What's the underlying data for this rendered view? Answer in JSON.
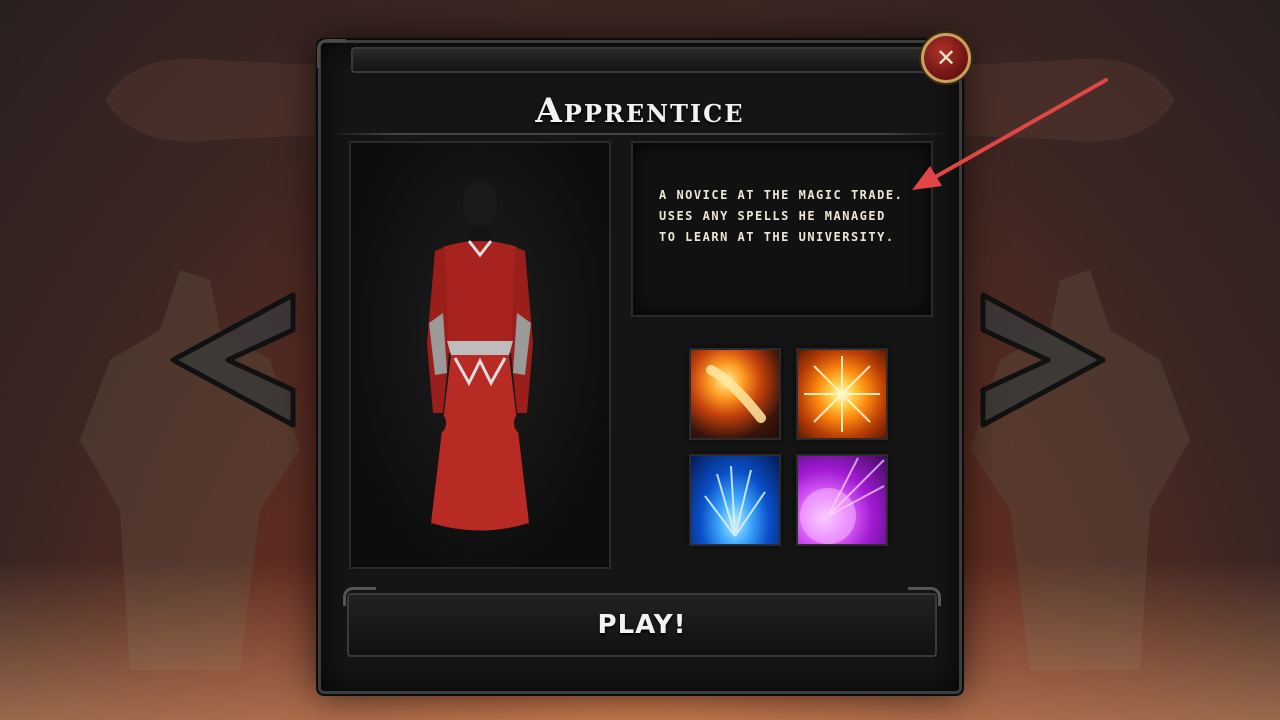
{
  "character": {
    "title": "Apprentice",
    "description": "A novice at the magic trade. Uses any spells he managed to learn at the university."
  },
  "buttons": {
    "close_label": "✕",
    "play_label": "PLAY!"
  },
  "spells": [
    {
      "name": "fireball"
    },
    {
      "name": "fire-burst"
    },
    {
      "name": "ice-shards"
    },
    {
      "name": "arcane-orb"
    }
  ],
  "colors": {
    "panel": "#151515",
    "close_button": "#8e1f18",
    "close_border": "#c8a060",
    "annotation_arrow": "#e04646",
    "robe": "#b82a24"
  }
}
